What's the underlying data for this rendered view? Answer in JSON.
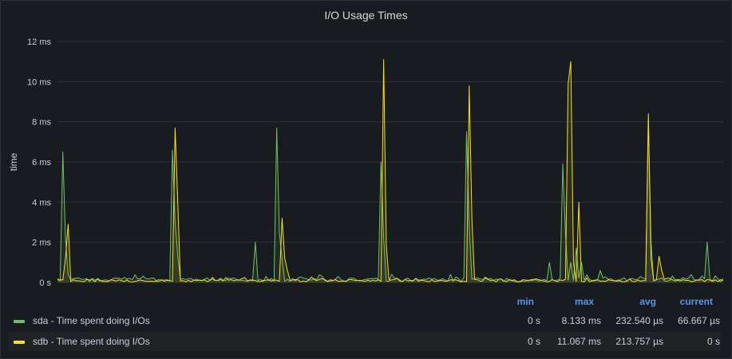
{
  "panel": {
    "title": "I/O Usage Times"
  },
  "chart_data": {
    "type": "line",
    "title": "I/O Usage Times",
    "ylabel": "time",
    "xlabel": "",
    "ylim": [
      0,
      12
    ],
    "yticks": [
      "0 s",
      "2 ms",
      "4 ms",
      "6 ms",
      "8 ms",
      "10 ms",
      "12 ms"
    ],
    "ytick_values": [
      0,
      2,
      4,
      6,
      8,
      10,
      12
    ],
    "x_points": 200,
    "grid": true,
    "legend_placement": "bottom",
    "series": [
      {
        "name": "sda - Time spent doing I/Os",
        "color": "#73bf69",
        "spikes": [
          [
            2,
            6.5
          ],
          [
            3,
            2.2
          ],
          [
            43,
            6.6
          ],
          [
            44,
            3.0
          ],
          [
            45,
            1.3
          ],
          [
            74,
            2.0
          ],
          [
            82,
            7.7
          ],
          [
            83,
            2.5
          ],
          [
            84,
            1.2
          ],
          [
            121,
            6.0
          ],
          [
            122,
            2.2
          ],
          [
            153,
            7.5
          ],
          [
            154,
            2.8
          ],
          [
            184,
            1.0
          ],
          [
            189,
            5.9
          ],
          [
            190,
            2.4
          ],
          [
            192,
            1.0
          ],
          [
            194,
            1.7
          ],
          [
            196,
            1.0
          ],
          [
            203,
            0.6
          ],
          [
            221,
            8.1
          ],
          [
            222,
            2.0
          ],
          [
            243,
            2.0
          ]
        ],
        "baseline": 0.12
      },
      {
        "name": "sdb - Time spent doing I/Os",
        "color": "#fade2a",
        "spikes": [
          [
            3,
            1.2
          ],
          [
            4,
            2.9
          ],
          [
            44,
            7.7
          ],
          [
            45,
            4.0
          ],
          [
            84,
            3.2
          ],
          [
            85,
            1.2
          ],
          [
            86,
            0.6
          ],
          [
            122,
            11.1
          ],
          [
            123,
            1.8
          ],
          [
            154,
            9.8
          ],
          [
            155,
            3.2
          ],
          [
            191,
            9.9
          ],
          [
            192,
            11.0
          ],
          [
            193,
            1.0
          ],
          [
            195,
            4.0
          ],
          [
            221,
            8.4
          ],
          [
            222,
            1.2
          ],
          [
            225,
            1.3
          ],
          [
            226,
            0.6
          ]
        ],
        "baseline": 0.08
      }
    ]
  },
  "legend": {
    "headers": {
      "min": "min",
      "max": "max",
      "avg": "avg",
      "current": "current"
    },
    "rows": [
      {
        "name": "sda - Time spent doing I/Os",
        "color": "#73bf69",
        "min": "0 s",
        "max": "8.133 ms",
        "avg": "232.540 µs",
        "current": "66.667 µs"
      },
      {
        "name": "sdb - Time spent doing I/Os",
        "color": "#fade2a",
        "min": "0 s",
        "max": "11.067 ms",
        "avg": "213.757 µs",
        "current": "0 s"
      }
    ]
  }
}
